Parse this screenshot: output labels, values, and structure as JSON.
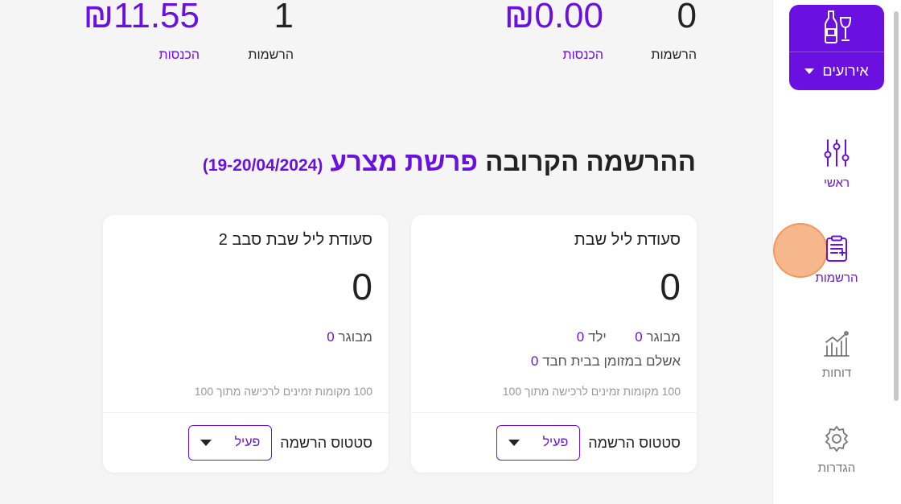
{
  "sidebar": {
    "events_label": "אירועים",
    "items": [
      {
        "label": "ראשי"
      },
      {
        "label": "הרשמות"
      },
      {
        "label": "דוחות"
      },
      {
        "label": "הגדרות"
      }
    ]
  },
  "stats": {
    "left": {
      "income": "₪11.55",
      "registrations": "1",
      "income_label": "הכנסות",
      "registrations_label": "הרשמות"
    },
    "right": {
      "income": "₪0.00",
      "registrations": "0",
      "income_label": "הכנסות",
      "registrations_label": "הרשמות"
    }
  },
  "heading": {
    "prefix": "ההרשמה הקרובה",
    "parasha": "פרשת מצרע",
    "date": "(19-20/04/2024)"
  },
  "cards": [
    {
      "title": "סעודת ליל שבת",
      "count": "0",
      "adult_label": "מבוגר",
      "adult_value": "0",
      "child_label": "ילד",
      "child_value": "0",
      "paid_label": "אשלם במזומן בבית חבד",
      "paid_value": "0",
      "seats": "100 מקומות זמינים לרכישה מתוך 100",
      "status_label": "סטטוס הרשמה",
      "status_value": "פעיל"
    },
    {
      "title": "סעודת ליל שבת סבב 2",
      "count": "0",
      "adult_label": "מבוגר",
      "adult_value": "0",
      "seats": "100 מקומות זמינים לרכישה מתוך 100",
      "status_label": "סטטוס הרשמה",
      "status_value": "פעיל"
    }
  ],
  "colors": {
    "accent": "#6a10e0",
    "background": "#f5f5f6",
    "highlight": "#f5aa78"
  }
}
